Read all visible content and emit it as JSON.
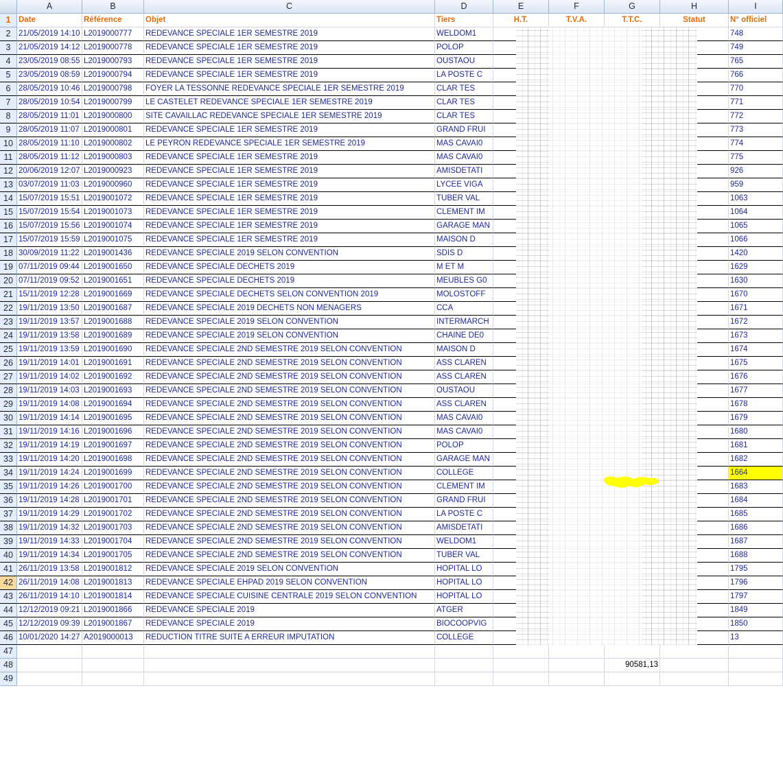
{
  "columns": [
    "A",
    "B",
    "C",
    "D",
    "E",
    "F",
    "G",
    "H",
    "I"
  ],
  "header_row": {
    "num": "1",
    "cells": [
      "Date",
      "Référence",
      "Objet",
      "Tiers",
      "H.T.",
      "T.V.A.",
      "T.T.C.",
      "Statut",
      "N° officiel"
    ]
  },
  "rows": [
    {
      "num": "2",
      "date": "21/05/2019 14:10",
      "ref": "L2019000777",
      "objet": "REDEVANCE SPECIALE 1ER SEMESTRE 2019",
      "tiers": "WELDOM1",
      "officiel": "748"
    },
    {
      "num": "3",
      "date": "21/05/2019 14:12",
      "ref": "L2019000778",
      "objet": "REDEVANCE SPECIALE 1ER SEMESTRE 2019",
      "tiers": "POLOP",
      "officiel": "749"
    },
    {
      "num": "4",
      "date": "23/05/2019 08:55",
      "ref": "L2019000793",
      "objet": "REDEVANCE SPECIALE 1ER SEMESTRE 2019",
      "tiers": "OUSTAOU",
      "officiel": "765"
    },
    {
      "num": "5",
      "date": "23/05/2019 08:59",
      "ref": "L2019000794",
      "objet": "REDEVANCE SPECIALE 1ER SEMESTRE 2019",
      "tiers": "LA POSTE C",
      "officiel": "766"
    },
    {
      "num": "6",
      "date": "28/05/2019 10:46",
      "ref": "L2019000798",
      "objet": "FOYER LA TESSONNE REDEVANCE SPECIALE 1ER SEMESTRE 2019",
      "tiers": "CLAR TES",
      "officiel": "770"
    },
    {
      "num": "7",
      "date": "28/05/2019 10:54",
      "ref": "L2019000799",
      "objet": "LE CASTELET REDEVANCE SPECIALE 1ER SEMESTRE 2019",
      "tiers": "CLAR TES",
      "officiel": "771"
    },
    {
      "num": "8",
      "date": "28/05/2019 11:01",
      "ref": "L2019000800",
      "objet": "SITE CAVAILLAC REDEVANCE SPECIALE 1ER SEMESTRE 2019",
      "tiers": "CLAR TES",
      "officiel": "772"
    },
    {
      "num": "9",
      "date": "28/05/2019 11:07",
      "ref": "L2019000801",
      "objet": "REDEVANCE SPECIALE 1ER SEMESTRE 2019",
      "tiers": "GRAND FRUI",
      "officiel": "773"
    },
    {
      "num": "10",
      "date": "28/05/2019 11:10",
      "ref": "L2019000802",
      "objet": "LE PEYRON REDEVANCE SPECIALE 1ER SEMESTRE 2019",
      "tiers": "MAS CAVAI0",
      "officiel": "774"
    },
    {
      "num": "11",
      "date": "28/05/2019 11:12",
      "ref": "L2019000803",
      "objet": "REDEVANCE SPECIALE 1ER SEMESTRE 2019",
      "tiers": "MAS CAVAI0",
      "officiel": "775"
    },
    {
      "num": "12",
      "date": "20/06/2019 12:07",
      "ref": "L2019000923",
      "objet": "REDEVANCE SPECIALE 1ER SEMESTRE 2019",
      "tiers": "AMISDETATI",
      "officiel": "926"
    },
    {
      "num": "13",
      "date": "03/07/2019 11:03",
      "ref": "L2019000960",
      "objet": "REDEVANCE SPECIALE 1ER SEMESTRE 2019",
      "tiers": "LYCEE VIGA",
      "officiel": "959"
    },
    {
      "num": "14",
      "date": "15/07/2019 15:51",
      "ref": "L2019001072",
      "objet": "REDEVANCE SPECIALE 1ER SEMESTRE 2019",
      "tiers": "TUBER VAL",
      "officiel": "1063"
    },
    {
      "num": "15",
      "date": "15/07/2019 15:54",
      "ref": "L2019001073",
      "objet": "REDEVANCE SPECIALE 1ER SEMESTRE 2019",
      "tiers": "CLEMENT IM",
      "officiel": "1064"
    },
    {
      "num": "16",
      "date": "15/07/2019 15:56",
      "ref": "L2019001074",
      "objet": "REDEVANCE SPECIALE 1ER SEMESTRE 2019",
      "tiers": "GARAGE MAN",
      "officiel": "1065"
    },
    {
      "num": "17",
      "date": "15/07/2019 15:59",
      "ref": "L2019001075",
      "objet": "REDEVANCE SPECIALE 1ER SEMESTRE 2019",
      "tiers": "MAISON D",
      "officiel": "1066"
    },
    {
      "num": "18",
      "date": "30/09/2019 11:22",
      "ref": "L2019001436",
      "objet": "REDEVANCE SPECIALE 2019 SELON CONVENTION",
      "tiers": "SDIS D",
      "officiel": "1420"
    },
    {
      "num": "19",
      "date": "07/11/2019 09:44",
      "ref": "L2019001650",
      "objet": "REDEVANCE SPECIALE DECHETS 2019",
      "tiers": "M ET M",
      "officiel": "1629"
    },
    {
      "num": "20",
      "date": "07/11/2019 09:52",
      "ref": "L2019001651",
      "objet": "REDEVANCE SPECIALE DECHETS 2019",
      "tiers": "MEUBLES G0",
      "officiel": "1630"
    },
    {
      "num": "21",
      "date": "15/11/2019 12:28",
      "ref": "L2019001669",
      "objet": "REDEVANCE SPECIALE DECHETS SELON CONVENTION 2019",
      "tiers": "MOLOSTOFF",
      "officiel": "1670"
    },
    {
      "num": "22",
      "date": "19/11/2019 13:50",
      "ref": "L2019001687",
      "objet": "REDEVANCE SPECIALE 2019 DECHETS NON MENAGERS",
      "tiers": "CCA",
      "officiel": "1671"
    },
    {
      "num": "23",
      "date": "19/11/2019 13:57",
      "ref": "L2019001688",
      "objet": "REDEVANCE SPECIALE 2019 SELON CONVENTION",
      "tiers": "INTERMARCH",
      "officiel": "1672"
    },
    {
      "num": "24",
      "date": "19/11/2019 13:58",
      "ref": "L2019001689",
      "objet": "REDEVANCE SPECIALE 2019 SELON CONVENTION",
      "tiers": "CHAINE DE0",
      "officiel": "1673"
    },
    {
      "num": "25",
      "date": "19/11/2019 13:59",
      "ref": "L2019001690",
      "objet": "REDEVANCE SPECIALE 2ND SEMESTRE 2019 SELON CONVENTION",
      "tiers": "MAISON D",
      "officiel": "1674"
    },
    {
      "num": "26",
      "date": "19/11/2019 14:01",
      "ref": "L2019001691",
      "objet": "REDEVANCE SPECIALE 2ND SEMESTRE 2019 SELON CONVENTION",
      "tiers": "ASS CLAREN",
      "officiel": "1675"
    },
    {
      "num": "27",
      "date": "19/11/2019 14:02",
      "ref": "L2019001692",
      "objet": "REDEVANCE SPECIALE 2ND SEMESTRE 2019 SELON CONVENTION",
      "tiers": "ASS CLAREN",
      "officiel": "1676"
    },
    {
      "num": "28",
      "date": "19/11/2019 14:03",
      "ref": "L2019001693",
      "objet": "REDEVANCE SPECIALE 2ND SEMESTRE 2019 SELON CONVENTION",
      "tiers": "OUSTAOU",
      "officiel": "1677"
    },
    {
      "num": "29",
      "date": "19/11/2019 14:08",
      "ref": "L2019001694",
      "objet": "REDEVANCE SPECIALE 2ND SEMESTRE 2019 SELON CONVENTION",
      "tiers": "ASS CLAREN",
      "officiel": "1678"
    },
    {
      "num": "30",
      "date": "19/11/2019 14:14",
      "ref": "L2019001695",
      "objet": "REDEVANCE SPECIALE 2ND SEMESTRE 2019 SELON CONVENTION",
      "tiers": "MAS CAVAI0",
      "officiel": "1679"
    },
    {
      "num": "31",
      "date": "19/11/2019 14:16",
      "ref": "L2019001696",
      "objet": "REDEVANCE SPECIALE 2ND SEMESTRE 2019 SELON CONVENTION",
      "tiers": "MAS CAVAI0",
      "officiel": "1680"
    },
    {
      "num": "32",
      "date": "19/11/2019 14:19",
      "ref": "L2019001697",
      "objet": "REDEVANCE SPECIALE 2ND SEMESTRE 2019 SELON CONVENTION",
      "tiers": "POLOP",
      "officiel": "1681"
    },
    {
      "num": "33",
      "date": "19/11/2019 14:20",
      "ref": "L2019001698",
      "objet": "REDEVANCE SPECIALE 2ND SEMESTRE 2019 SELON CONVENTION",
      "tiers": "GARAGE MAN",
      "officiel": "1682"
    },
    {
      "num": "34",
      "date": "19/11/2019 14:24",
      "ref": "L2019001699",
      "objet": "REDEVANCE SPECIALE 2ND SEMESTRE 2019 SELON CONVENTION",
      "tiers": "COLLEGE",
      "officiel": "1664",
      "highlight": true
    },
    {
      "num": "35",
      "date": "19/11/2019 14:26",
      "ref": "L2019001700",
      "objet": "REDEVANCE SPECIALE 2ND SEMESTRE 2019 SELON CONVENTION",
      "tiers": "CLEMENT IM",
      "officiel": "1683"
    },
    {
      "num": "36",
      "date": "19/11/2019 14:28",
      "ref": "L2019001701",
      "objet": "REDEVANCE SPECIALE 2ND SEMESTRE 2019 SELON CONVENTION",
      "tiers": "GRAND FRUI",
      "officiel": "1684"
    },
    {
      "num": "37",
      "date": "19/11/2019 14:29",
      "ref": "L2019001702",
      "objet": "REDEVANCE SPECIALE 2ND SEMESTRE 2019 SELON CONVENTION",
      "tiers": "LA POSTE C",
      "officiel": "1685"
    },
    {
      "num": "38",
      "date": "19/11/2019 14:32",
      "ref": "L2019001703",
      "objet": "REDEVANCE SPECIALE 2ND SEMESTRE 2019 SELON CONVENTION",
      "tiers": "AMISDETATI",
      "officiel": "1686"
    },
    {
      "num": "39",
      "date": "19/11/2019 14:33",
      "ref": "L2019001704",
      "objet": "REDEVANCE SPECIALE 2ND SEMESTRE 2019 SELON CONVENTION",
      "tiers": "WELDOM1",
      "officiel": "1687"
    },
    {
      "num": "40",
      "date": "19/11/2019 14:34",
      "ref": "L2019001705",
      "objet": "REDEVANCE SPECIALE 2ND SEMESTRE 2019 SELON CONVENTION",
      "tiers": "TUBER VAL",
      "officiel": "1688"
    },
    {
      "num": "41",
      "date": "26/11/2019 13:58",
      "ref": "L2019001812",
      "objet": "REDEVANCE SPECIALE 2019 SELON CONVENTION",
      "tiers": "HOPITAL LO",
      "officiel": "1795"
    },
    {
      "num": "42",
      "date": "26/11/2019 14:08",
      "ref": "L2019001813",
      "objet": "REDEVANCE SPECIALE EHPAD 2019 SELON CONVENTION",
      "tiers": "HOPITAL LO",
      "officiel": "1796",
      "active": true
    },
    {
      "num": "43",
      "date": "26/11/2019 14:10",
      "ref": "L2019001814",
      "objet": "REDEVANCE SPECIALE CUISINE CENTRALE 2019 SELON CONVENTION",
      "tiers": "HOPITAL LO",
      "officiel": "1797"
    },
    {
      "num": "44",
      "date": "12/12/2019 09:21",
      "ref": "L2019001866",
      "objet": "REDEVANCE SPECIALE 2019",
      "tiers": "ATGER",
      "officiel": "1849"
    },
    {
      "num": "45",
      "date": "12/12/2019 09:39",
      "ref": "L2019001867",
      "objet": "REDEVANCE SPECIALE 2019",
      "tiers": "BIOCOOPVIG",
      "officiel": "1850"
    },
    {
      "num": "46",
      "date": "10/01/2020 14:27",
      "ref": "A2019000013",
      "objet": "REDUCTION TITRE SUITE A ERREUR IMPUTATION",
      "tiers": "COLLEGE",
      "officiel": "13"
    }
  ],
  "empty_rows": [
    "47",
    "49"
  ],
  "total_row": {
    "num": "48",
    "ttc_total": "90581,13"
  },
  "colors": {
    "header_text": "#e26b0a",
    "cell_text": "#1f2a9a",
    "highlight": "#ffff00",
    "grid": "#d0d7e5"
  }
}
